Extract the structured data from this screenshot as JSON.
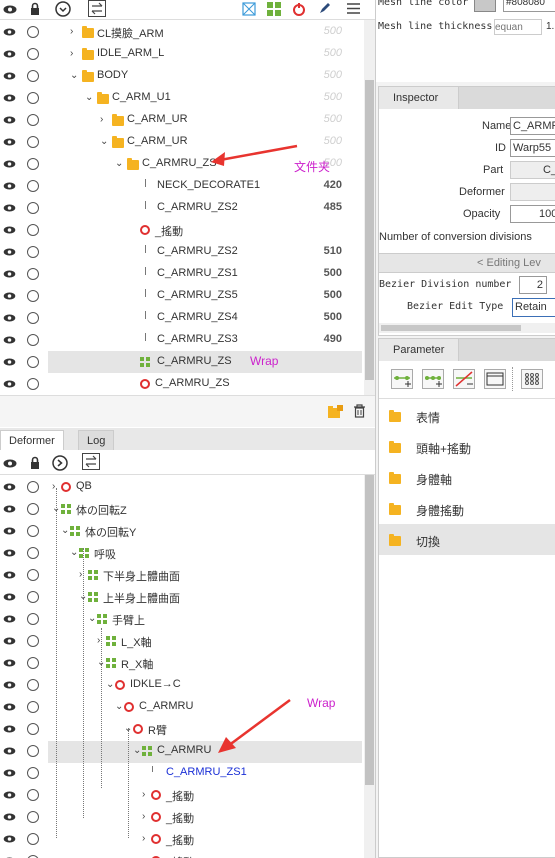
{
  "top_toolbar": {
    "icons": [
      "eye-icon",
      "lock-icon",
      "chevron-circle-icon",
      "swap-icon",
      "mesh-icon",
      "green-grid-icon",
      "red-ring-icon",
      "pen-icon",
      "menu-icon"
    ]
  },
  "parts_tree": [
    {
      "label": "CL摸臉_ARM",
      "num": "500",
      "dim": true
    },
    {
      "label": "IDLE_ARM_L",
      "num": "500",
      "dim": true
    },
    {
      "label": "BODY",
      "num": "500",
      "dim": true
    },
    {
      "label": "C_ARM_U1",
      "num": "500",
      "dim": true
    },
    {
      "label": "C_ARM_UR",
      "num": "500",
      "dim": true
    },
    {
      "label": "C_ARM_UR",
      "num": "500",
      "dim": true
    },
    {
      "label": "C_ARMRU_ZS",
      "num": "500",
      "dim": true
    },
    {
      "label": "NECK_DECORATE1",
      "num": "420",
      "dim": false
    },
    {
      "label": "C_ARMRU_ZS2",
      "num": "485",
      "dim": false
    },
    {
      "label": "_搖動",
      "num": "",
      "dim": false
    },
    {
      "label": "C_ARMRU_ZS2",
      "num": "510",
      "dim": false
    },
    {
      "label": "C_ARMRU_ZS1",
      "num": "500",
      "dim": false
    },
    {
      "label": "C_ARMRU_ZS5",
      "num": "500",
      "dim": false
    },
    {
      "label": "C_ARMRU_ZS4",
      "num": "500",
      "dim": false
    },
    {
      "label": "C_ARMRU_ZS3",
      "num": "490",
      "dim": false
    },
    {
      "label": "C_ARMRU_ZS",
      "num": "",
      "dim": false
    },
    {
      "label": "C_ARMRU_ZS",
      "num": "",
      "dim": false
    }
  ],
  "annotations": {
    "folder_note": "文件夹",
    "wrap_note_top": "Wrap",
    "wrap_note_bottom": "Wrap"
  },
  "deformer_panel": {
    "tabs": [
      "Deformer",
      "Log"
    ],
    "items": [
      {
        "label": "QB"
      },
      {
        "label": "体の回転Z"
      },
      {
        "label": "体の回転Y"
      },
      {
        "label": "呼吸"
      },
      {
        "label": "下半身上體曲面"
      },
      {
        "label": "上半身上體曲面"
      },
      {
        "label": "手臂上"
      },
      {
        "label": "L_X軸"
      },
      {
        "label": "R_X軸"
      },
      {
        "label": "IDKLE→C"
      },
      {
        "label": "C_ARMRU"
      },
      {
        "label": "R臂"
      },
      {
        "label": "C_ARMRU"
      },
      {
        "label": "C_ARMRU_ZS1"
      },
      {
        "label": "_搖動"
      },
      {
        "label": "_搖動"
      },
      {
        "label": "_搖動"
      },
      {
        "label": "_搖動"
      }
    ]
  },
  "mesh_settings": {
    "mesh_line_color_label": "Mesh line color",
    "mesh_line_color_value": "#808080",
    "mesh_line_thickness_label": "Mesh line thickness",
    "mesh_line_thickness_placeholder": "equan",
    "mesh_line_thickness_value": "1."
  },
  "inspector": {
    "title": "Inspector",
    "name_label": "Name",
    "name_value": "C_ARMRU",
    "id_label": "ID",
    "id_value": "Warp55",
    "part_label": "Part",
    "part_value": "C_",
    "deformer_label": "Deformer",
    "deformer_value": "",
    "opacity_label": "Opacity",
    "opacity_value": "100",
    "conversion_label": "Number of conversion divisions",
    "editing_level": "< Editing Lev",
    "bezier_division_label": "Bezier Division number",
    "bezier_division_value": "2",
    "bezier_edit_type_label": "Bezier Edit Type",
    "bezier_edit_type_value": "Retain"
  },
  "parameter": {
    "title": "Parameter",
    "groups": [
      {
        "label": "表情"
      },
      {
        "label": "頭軸+搖動"
      },
      {
        "label": "身體軸"
      },
      {
        "label": "身體搖動"
      },
      {
        "label": "切換"
      }
    ]
  },
  "colors": {
    "accent_red": "#e8342f",
    "annotation_magenta": "#cc22cc",
    "folder": "#f5b321",
    "green": "#6fb13c",
    "selected_row": "#e5e5e5"
  }
}
